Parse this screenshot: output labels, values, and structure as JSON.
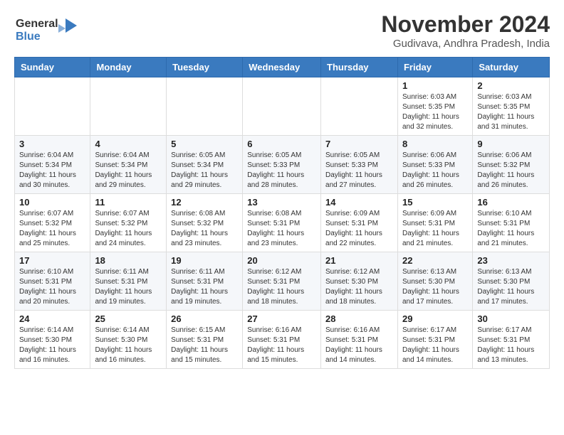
{
  "header": {
    "logo_line1": "General",
    "logo_line2": "Blue",
    "month": "November 2024",
    "location": "Gudivava, Andhra Pradesh, India"
  },
  "weekdays": [
    "Sunday",
    "Monday",
    "Tuesday",
    "Wednesday",
    "Thursday",
    "Friday",
    "Saturday"
  ],
  "weeks": [
    [
      {
        "day": "",
        "info": ""
      },
      {
        "day": "",
        "info": ""
      },
      {
        "day": "",
        "info": ""
      },
      {
        "day": "",
        "info": ""
      },
      {
        "day": "",
        "info": ""
      },
      {
        "day": "1",
        "info": "Sunrise: 6:03 AM\nSunset: 5:35 PM\nDaylight: 11 hours\nand 32 minutes."
      },
      {
        "day": "2",
        "info": "Sunrise: 6:03 AM\nSunset: 5:35 PM\nDaylight: 11 hours\nand 31 minutes."
      }
    ],
    [
      {
        "day": "3",
        "info": "Sunrise: 6:04 AM\nSunset: 5:34 PM\nDaylight: 11 hours\nand 30 minutes."
      },
      {
        "day": "4",
        "info": "Sunrise: 6:04 AM\nSunset: 5:34 PM\nDaylight: 11 hours\nand 29 minutes."
      },
      {
        "day": "5",
        "info": "Sunrise: 6:05 AM\nSunset: 5:34 PM\nDaylight: 11 hours\nand 29 minutes."
      },
      {
        "day": "6",
        "info": "Sunrise: 6:05 AM\nSunset: 5:33 PM\nDaylight: 11 hours\nand 28 minutes."
      },
      {
        "day": "7",
        "info": "Sunrise: 6:05 AM\nSunset: 5:33 PM\nDaylight: 11 hours\nand 27 minutes."
      },
      {
        "day": "8",
        "info": "Sunrise: 6:06 AM\nSunset: 5:33 PM\nDaylight: 11 hours\nand 26 minutes."
      },
      {
        "day": "9",
        "info": "Sunrise: 6:06 AM\nSunset: 5:32 PM\nDaylight: 11 hours\nand 26 minutes."
      }
    ],
    [
      {
        "day": "10",
        "info": "Sunrise: 6:07 AM\nSunset: 5:32 PM\nDaylight: 11 hours\nand 25 minutes."
      },
      {
        "day": "11",
        "info": "Sunrise: 6:07 AM\nSunset: 5:32 PM\nDaylight: 11 hours\nand 24 minutes."
      },
      {
        "day": "12",
        "info": "Sunrise: 6:08 AM\nSunset: 5:32 PM\nDaylight: 11 hours\nand 23 minutes."
      },
      {
        "day": "13",
        "info": "Sunrise: 6:08 AM\nSunset: 5:31 PM\nDaylight: 11 hours\nand 23 minutes."
      },
      {
        "day": "14",
        "info": "Sunrise: 6:09 AM\nSunset: 5:31 PM\nDaylight: 11 hours\nand 22 minutes."
      },
      {
        "day": "15",
        "info": "Sunrise: 6:09 AM\nSunset: 5:31 PM\nDaylight: 11 hours\nand 21 minutes."
      },
      {
        "day": "16",
        "info": "Sunrise: 6:10 AM\nSunset: 5:31 PM\nDaylight: 11 hours\nand 21 minutes."
      }
    ],
    [
      {
        "day": "17",
        "info": "Sunrise: 6:10 AM\nSunset: 5:31 PM\nDaylight: 11 hours\nand 20 minutes."
      },
      {
        "day": "18",
        "info": "Sunrise: 6:11 AM\nSunset: 5:31 PM\nDaylight: 11 hours\nand 19 minutes."
      },
      {
        "day": "19",
        "info": "Sunrise: 6:11 AM\nSunset: 5:31 PM\nDaylight: 11 hours\nand 19 minutes."
      },
      {
        "day": "20",
        "info": "Sunrise: 6:12 AM\nSunset: 5:31 PM\nDaylight: 11 hours\nand 18 minutes."
      },
      {
        "day": "21",
        "info": "Sunrise: 6:12 AM\nSunset: 5:30 PM\nDaylight: 11 hours\nand 18 minutes."
      },
      {
        "day": "22",
        "info": "Sunrise: 6:13 AM\nSunset: 5:30 PM\nDaylight: 11 hours\nand 17 minutes."
      },
      {
        "day": "23",
        "info": "Sunrise: 6:13 AM\nSunset: 5:30 PM\nDaylight: 11 hours\nand 17 minutes."
      }
    ],
    [
      {
        "day": "24",
        "info": "Sunrise: 6:14 AM\nSunset: 5:30 PM\nDaylight: 11 hours\nand 16 minutes."
      },
      {
        "day": "25",
        "info": "Sunrise: 6:14 AM\nSunset: 5:30 PM\nDaylight: 11 hours\nand 16 minutes."
      },
      {
        "day": "26",
        "info": "Sunrise: 6:15 AM\nSunset: 5:31 PM\nDaylight: 11 hours\nand 15 minutes."
      },
      {
        "day": "27",
        "info": "Sunrise: 6:16 AM\nSunset: 5:31 PM\nDaylight: 11 hours\nand 15 minutes."
      },
      {
        "day": "28",
        "info": "Sunrise: 6:16 AM\nSunset: 5:31 PM\nDaylight: 11 hours\nand 14 minutes."
      },
      {
        "day": "29",
        "info": "Sunrise: 6:17 AM\nSunset: 5:31 PM\nDaylight: 11 hours\nand 14 minutes."
      },
      {
        "day": "30",
        "info": "Sunrise: 6:17 AM\nSunset: 5:31 PM\nDaylight: 11 hours\nand 13 minutes."
      }
    ]
  ]
}
